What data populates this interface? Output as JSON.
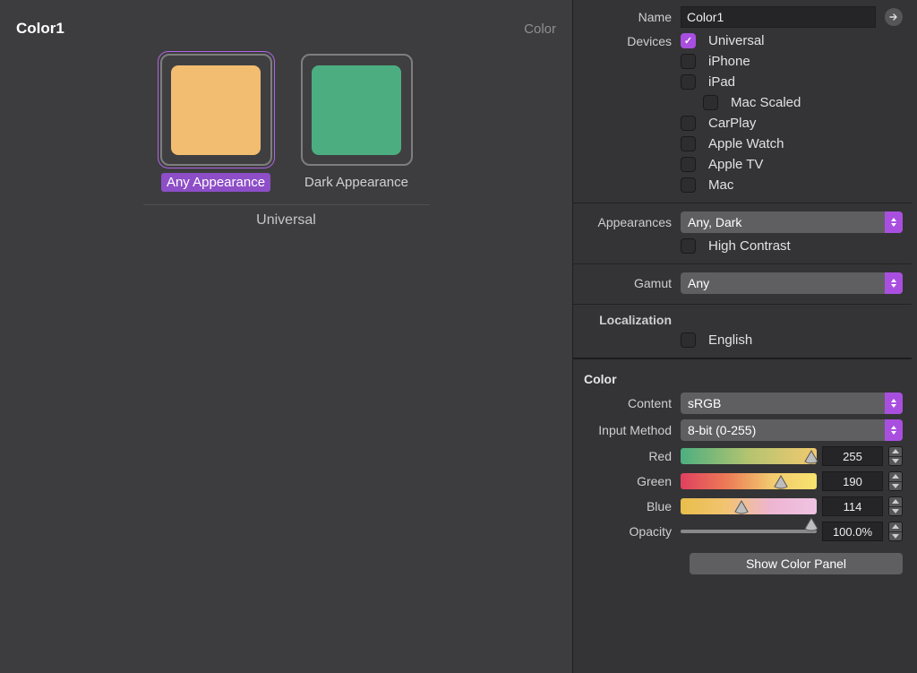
{
  "left": {
    "title": "Color1",
    "kind": "Color",
    "swatches": [
      {
        "label": "Any Appearance",
        "color": "#f2bd71",
        "selected": true
      },
      {
        "label": "Dark Appearance",
        "color": "#4cae80",
        "selected": false
      }
    ],
    "setName": "Universal"
  },
  "inspector": {
    "nameLabel": "Name",
    "nameValue": "Color1",
    "devicesLabel": "Devices",
    "devices": [
      {
        "label": "Universal",
        "checked": true,
        "indent": 0
      },
      {
        "label": "iPhone",
        "checked": false,
        "indent": 0
      },
      {
        "label": "iPad",
        "checked": false,
        "indent": 0
      },
      {
        "label": "Mac Scaled",
        "checked": false,
        "indent": 1
      },
      {
        "label": "CarPlay",
        "checked": false,
        "indent": 0
      },
      {
        "label": "Apple Watch",
        "checked": false,
        "indent": 0
      },
      {
        "label": "Apple TV",
        "checked": false,
        "indent": 0
      },
      {
        "label": "Mac",
        "checked": false,
        "indent": 0
      }
    ],
    "appearancesLabel": "Appearances",
    "appearancesValue": "Any, Dark",
    "highContrast": {
      "label": "High Contrast",
      "checked": false
    },
    "gamutLabel": "Gamut",
    "gamutValue": "Any",
    "localizationLabel": "Localization",
    "localization": {
      "label": "English",
      "checked": false
    },
    "colorSection": "Color",
    "contentLabel": "Content",
    "contentValue": "sRGB",
    "inputMethodLabel": "Input Method",
    "inputMethodValue": "8-bit (0-255)",
    "sliders": {
      "red": {
        "label": "Red",
        "value": "255",
        "pct": 100,
        "gradient": "linear-gradient(90deg,#4cae80,#e8d46a,#f2c96f)"
      },
      "green": {
        "label": "Green",
        "value": "190",
        "pct": 74,
        "gradient": "linear-gradient(90deg,#e0405f,#e96d56,#f2c96f,#f7e36f)"
      },
      "blue": {
        "label": "Blue",
        "value": "114",
        "pct": 45,
        "gradient": "linear-gradient(90deg,#e8be4a,#f2c371,#edb5d2,#f0c3e3)"
      },
      "opacity": {
        "label": "Opacity",
        "value": "100.0%",
        "pct": 100
      }
    },
    "showColorPanel": "Show Color Panel"
  }
}
